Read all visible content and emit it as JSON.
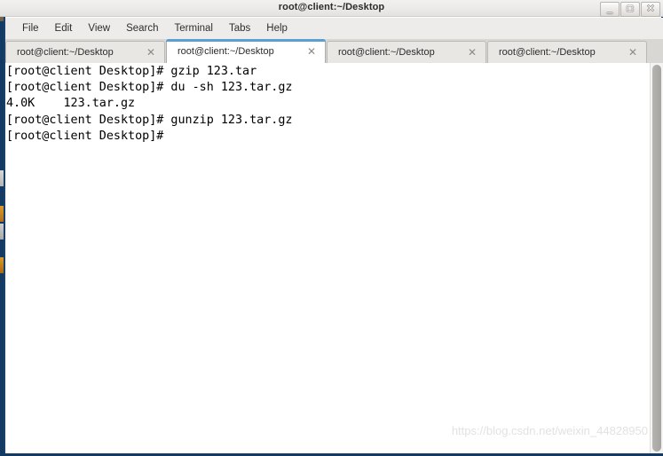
{
  "window": {
    "title": "root@client:~/Desktop",
    "controls": [
      {
        "name": "minimize",
        "glyph": "_"
      },
      {
        "name": "maximize",
        "glyph": "□"
      },
      {
        "name": "close",
        "glyph": "✕"
      }
    ]
  },
  "menubar": {
    "items": [
      {
        "label": "File"
      },
      {
        "label": "Edit"
      },
      {
        "label": "View"
      },
      {
        "label": "Search"
      },
      {
        "label": "Terminal"
      },
      {
        "label": "Tabs"
      },
      {
        "label": "Help"
      }
    ]
  },
  "tabs": [
    {
      "label": "root@client:~/Desktop",
      "close": "✕",
      "active": false
    },
    {
      "label": "root@client:~/Desktop",
      "close": "✕",
      "active": true
    },
    {
      "label": "root@client:~/Desktop",
      "close": "✕",
      "active": false
    },
    {
      "label": "root@client:~/Desktop",
      "close": "✕",
      "active": false
    }
  ],
  "terminal": {
    "lines": [
      "[root@client Desktop]# gzip 123.tar",
      "[root@client Desktop]# du -sh 123.tar.gz",
      "4.0K    123.tar.gz",
      "[root@client Desktop]# gunzip 123.tar.gz",
      "[root@client Desktop]#"
    ],
    "watermark": "https://blog.csdn.net/weixin_44828950"
  },
  "colors": {
    "desktop_background": "#123a63",
    "window_border": "#1b3f6b",
    "titlebar": "#eceae8",
    "menubar": "#edecea",
    "tabbar": "#d9d7d4",
    "active_tab_accent": "#5a9fd4",
    "terminal_background": "#ffffff",
    "terminal_foreground": "#000000",
    "scrollbar_thumb": "#a6a4a1"
  }
}
